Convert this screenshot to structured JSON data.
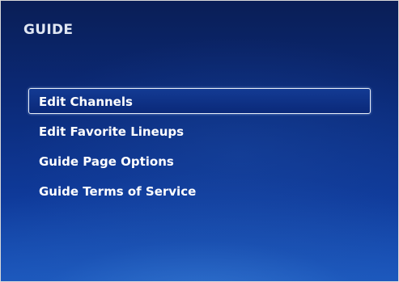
{
  "header": {
    "title": "GUIDE"
  },
  "menu": {
    "items": [
      {
        "label": "Edit Channels",
        "focused": true
      },
      {
        "label": "Edit Favorite Lineups",
        "focused": false
      },
      {
        "label": "Guide Page Options",
        "focused": false
      },
      {
        "label": "Guide Terms of Service",
        "focused": false
      }
    ]
  },
  "colors": {
    "background_top": "#0a1e56",
    "background_bottom": "#1a56bd",
    "text": "#ffffff",
    "header_text": "#dfe6f2",
    "focus_border": "#e8eef8"
  }
}
